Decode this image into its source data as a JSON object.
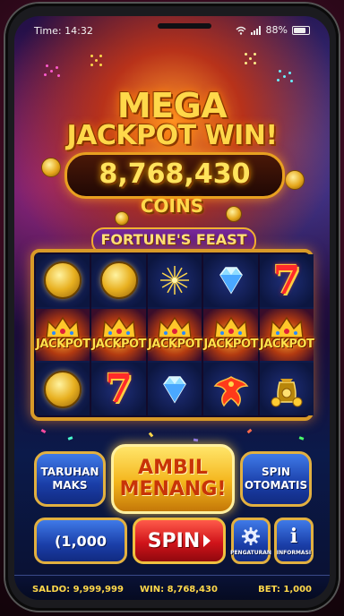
{
  "status_bar": {
    "time": "Time: 14:32",
    "battery": "88%"
  },
  "headline": {
    "line1": "MEGA",
    "line2": "JACKPOT WIN!"
  },
  "win_amount": "8,768,430",
  "win_unit": "COINS",
  "game_title": "FORTUNE'S FEAST",
  "reels": [
    [
      "coin",
      "jackpot",
      "coin"
    ],
    [
      "coin",
      "jackpot",
      "seven"
    ],
    [
      "fireworks",
      "jackpot",
      "diamond"
    ],
    [
      "diamond",
      "jackpot",
      "phoenix"
    ],
    [
      "seven",
      "jackpot",
      "coin-bag"
    ]
  ],
  "jackpot_symbol_text": "JACKPOT",
  "buttons": {
    "max_bet": "TARUHAN MAKS",
    "collect": "AMBIL MENANG!",
    "auto_spin": "SPIN OTOMATIS",
    "bet_value": "(1,000",
    "spin": "SPIN",
    "settings": "PENGATURAN",
    "info": "INFORMASI"
  },
  "footer": {
    "balance": "SALDO: 9,999,999",
    "win": "WIN: 8,768,430",
    "bet": "BET: 1,000"
  },
  "colors": {
    "gold": "#ffd84a",
    "blue_button": "#1a3ea8",
    "spin_red": "#d0141a"
  }
}
